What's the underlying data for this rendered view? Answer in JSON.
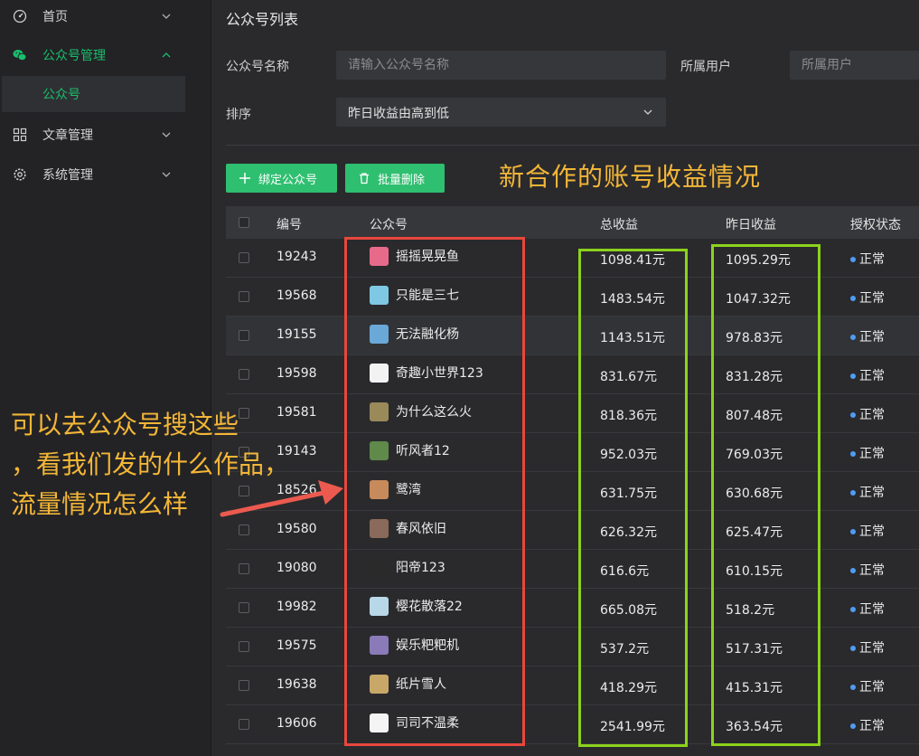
{
  "sidebar": {
    "items": [
      {
        "label": "首页",
        "icon": "dashboard-icon"
      },
      {
        "label": "公众号管理",
        "icon": "wechat-icon",
        "active": true
      },
      {
        "label": "文章管理",
        "icon": "grid-icon"
      },
      {
        "label": "系统管理",
        "icon": "gear-icon"
      }
    ],
    "subitem": "公众号"
  },
  "main": {
    "title": "公众号列表",
    "filters": {
      "name_label": "公众号名称",
      "name_placeholder": "请输入公众号名称",
      "owner_label": "所属用户",
      "owner_placeholder": "所属用户",
      "sort_label": "排序",
      "sort_value": "昨日收益由高到低"
    },
    "buttons": {
      "bind": "绑定公众号",
      "batch_delete": "批量删除"
    },
    "table": {
      "headers": [
        "编号",
        "公众号",
        "总收益",
        "昨日收益",
        "授权状态"
      ],
      "rows": [
        {
          "id": "19243",
          "name": "摇摇晃晃鱼",
          "total": "1098.41元",
          "yesterday": "1095.29元",
          "status": "正常"
        },
        {
          "id": "19568",
          "name": "只能是三七",
          "total": "1483.54元",
          "yesterday": "1047.32元",
          "status": "正常"
        },
        {
          "id": "19155",
          "name": "无法融化杨",
          "total": "1143.51元",
          "yesterday": "978.83元",
          "status": "正常"
        },
        {
          "id": "19598",
          "name": "奇趣小世界123",
          "total": "831.67元",
          "yesterday": "831.28元",
          "status": "正常"
        },
        {
          "id": "19581",
          "name": "为什么这么火",
          "total": "818.36元",
          "yesterday": "807.48元",
          "status": "正常"
        },
        {
          "id": "19143",
          "name": "听风者12",
          "total": "952.03元",
          "yesterday": "769.03元",
          "status": "正常"
        },
        {
          "id": "18526",
          "name": "鹭湾",
          "total": "631.75元",
          "yesterday": "630.68元",
          "status": "正常"
        },
        {
          "id": "19580",
          "name": "春风依旧",
          "total": "626.32元",
          "yesterday": "625.47元",
          "status": "正常"
        },
        {
          "id": "19080",
          "name": "阳帝123",
          "total": "616.6元",
          "yesterday": "610.15元",
          "status": "正常"
        },
        {
          "id": "19982",
          "name": "樱花散落22",
          "total": "665.08元",
          "yesterday": "518.2元",
          "status": "正常"
        },
        {
          "id": "19575",
          "name": "娱乐粑粑机",
          "total": "537.2元",
          "yesterday": "517.31元",
          "status": "正常"
        },
        {
          "id": "19638",
          "name": "纸片雪人",
          "total": "418.29元",
          "yesterday": "415.31元",
          "status": "正常"
        },
        {
          "id": "19606",
          "name": "司司不温柔",
          "total": "2541.99元",
          "yesterday": "363.54元",
          "status": "正常"
        }
      ]
    }
  },
  "annotations": {
    "right_title": "新合作的账号收益情况",
    "left_lines": [
      "可以去公众号搜这些",
      "，看我们发的什么作品，",
      "流量情况怎么样"
    ]
  },
  "colors": {
    "accent": "#19be6b",
    "button": "#2fbf70",
    "annotation_text": "#f3b637",
    "box_red": "#e8473d",
    "box_green": "#8cd21c",
    "status_dot": "#4f9cf5"
  }
}
